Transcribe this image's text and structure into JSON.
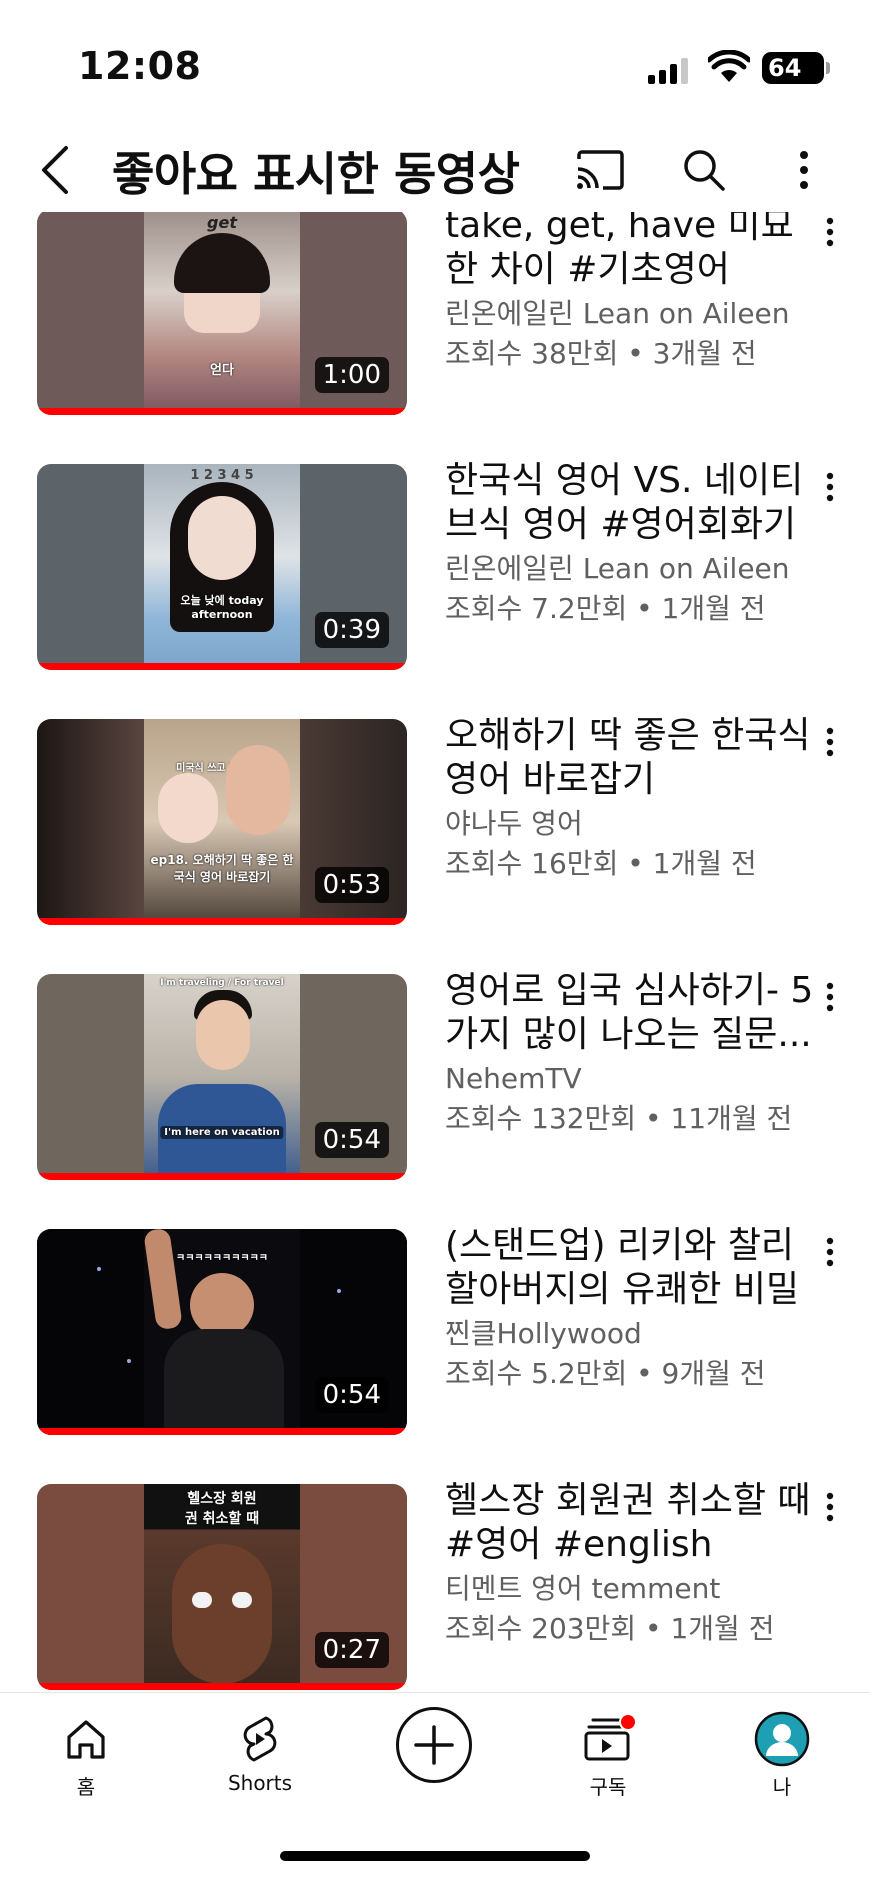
{
  "status_bar": {
    "time": "12:08",
    "battery": "64"
  },
  "header": {
    "title": "좋아요 표시한 동영상"
  },
  "videos": [
    {
      "title": "take, get, have 미묘한 차이 #기초영어",
      "channel": "린온에일린 Lean on Aileen",
      "views": "조회수 38만회",
      "age": "3개월 전",
      "stats": "조회수 38만회 • 3개월 전",
      "duration": "1:00",
      "thumb_top_text": "get",
      "thumb_caption": "얻다",
      "thumb_side_color": "#6e5a58",
      "thumb_center_color": "#8a7a74"
    },
    {
      "title": "한국식 영어 VS. 네이티브식 영어 #영어회화기초",
      "channel": "린온에일린 Lean on Aileen",
      "views": "조회수 7.2만회",
      "age": "1개월 전",
      "stats": "조회수 7.2만회 • 1개월 전",
      "duration": "0:39",
      "thumb_top_text": "1 2 3 4 5",
      "thumb_caption": "오늘 낮에 today afternoon",
      "thumb_side_color": "#5c6469",
      "thumb_center_color": "#a9b4bd"
    },
    {
      "title": "오해하기 딱 좋은 한국식 영어 바로잡기",
      "channel": "야나두 영어",
      "views": "조회수 16만회",
      "age": "1개월 전",
      "stats": "조회수 16만회 • 1개월 전",
      "duration": "0:53",
      "thumb_top_text": "미국식 쓰고 절대 X해",
      "thumb_caption": "ep18. 오해하기 딱 좋은 한국식 영어 바로잡기",
      "thumb_side_color": "#2c2523",
      "thumb_center_color": "#c9b59a"
    },
    {
      "title": "영어로 입국 심사하기- 5가지 많이 나오는 질문...",
      "channel": "NehemTV",
      "views": "조회수 132만회",
      "age": "11개월 전",
      "stats": "조회수 132만회 • 11개월 전",
      "duration": "0:54",
      "thumb_top_text": "I'm traveling / For travel",
      "thumb_caption": "I'm here on vacation",
      "thumb_side_color": "#6f665e",
      "thumb_center_color": "#c8c4bc"
    },
    {
      "title": "(스탠드업) 리키와 찰리 할아버지의 유쾌한 비밀",
      "channel": "찐클Hollywood",
      "views": "조회수 5.2만회",
      "age": "9개월 전",
      "stats": "조회수 5.2만회 • 9개월 전",
      "duration": "0:54",
      "thumb_top_text": "ㅋㅋㅋㅋㅋㅋㅋㅋㅋㅋ",
      "thumb_caption": "",
      "thumb_side_color": "#050507",
      "thumb_center_color": "#0a0a0f"
    },
    {
      "title": "헬스장 회원권 취소할 때 #영어 #english",
      "channel": "티멘트 영어 temment",
      "views": "조회수 203만회",
      "age": "1개월 전",
      "stats": "조회수 203만회 • 1개월 전",
      "duration": "0:27",
      "thumb_top_text": "헬스장 회원권 취소할 때",
      "thumb_caption": "",
      "thumb_side_color": "#7a4b3f",
      "thumb_center_color": "#3a2a22"
    }
  ],
  "bottom_nav": {
    "home": "홈",
    "shorts": "Shorts",
    "subscriptions": "구독",
    "you": "나"
  },
  "colors": {
    "accent_red": "#ff0000",
    "text_primary": "#0f0f0f",
    "text_secondary": "#606060",
    "avatar_teal": "#1e9fb3"
  }
}
